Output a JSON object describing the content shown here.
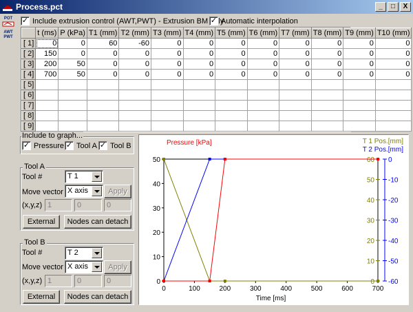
{
  "window": {
    "title": "Process.pct",
    "buttons": {
      "minimize": "_",
      "maximize": "□",
      "close": "X"
    }
  },
  "toolbar_icons": [
    {
      "name": "pot-tool-icon",
      "text": "POT"
    },
    {
      "name": "awt-pwt-tool-icon",
      "text": "AWT PWT"
    }
  ],
  "options": {
    "extrusion_control": {
      "label": "Include extrusion control (AWT,PWT) - Extrusion BM only",
      "checked": true
    },
    "auto_interpolation": {
      "label": "Automatic interpolation",
      "checked": true
    }
  },
  "table": {
    "columns": [
      "t (ms)",
      "P (kPa)",
      "T1 (mm)",
      "T2 (mm)",
      "T3 (mm)",
      "T4 (mm)",
      "T5 (mm)",
      "T6 (mm)",
      "T7 (mm)",
      "T8 (mm)",
      "T9 (mm)",
      "T10 (mm)"
    ],
    "rows": [
      {
        "label": "[ 1]",
        "cells": [
          "0",
          "0",
          "60",
          "-60",
          "0",
          "0",
          "0",
          "0",
          "0",
          "0",
          "0",
          "0"
        ]
      },
      {
        "label": "[ 2]",
        "cells": [
          "150",
          "0",
          "0",
          "0",
          "0",
          "0",
          "0",
          "0",
          "0",
          "0",
          "0",
          "0"
        ]
      },
      {
        "label": "[ 3]",
        "cells": [
          "200",
          "50",
          "0",
          "0",
          "0",
          "0",
          "0",
          "0",
          "0",
          "0",
          "0",
          "0"
        ]
      },
      {
        "label": "[ 4]",
        "cells": [
          "700",
          "50",
          "0",
          "0",
          "0",
          "0",
          "0",
          "0",
          "0",
          "0",
          "0",
          "0"
        ]
      },
      {
        "label": "[ 5]",
        "cells": [
          "",
          "",
          "",
          "",
          "",
          "",
          "",
          "",
          "",
          "",
          "",
          ""
        ]
      },
      {
        "label": "[ 6]",
        "cells": [
          "",
          "",
          "",
          "",
          "",
          "",
          "",
          "",
          "",
          "",
          "",
          ""
        ]
      },
      {
        "label": "[ 7]",
        "cells": [
          "",
          "",
          "",
          "",
          "",
          "",
          "",
          "",
          "",
          "",
          "",
          ""
        ]
      },
      {
        "label": "[ 8]",
        "cells": [
          "",
          "",
          "",
          "",
          "",
          "",
          "",
          "",
          "",
          "",
          "",
          ""
        ]
      },
      {
        "label": "[ 9]",
        "cells": [
          "",
          "",
          "",
          "",
          "",
          "",
          "",
          "",
          "",
          "",
          "",
          ""
        ]
      }
    ]
  },
  "include_graph": {
    "title": "Include to graph...",
    "pressure": {
      "label": "Pressure",
      "checked": true
    },
    "tool_a": {
      "label": "Tool A",
      "checked": true
    },
    "tool_b": {
      "label": "Tool B",
      "checked": true
    }
  },
  "tool_a": {
    "title": "Tool A",
    "tool_label": "Tool #",
    "tool_value": "T 1",
    "move_label": "Move vector",
    "move_value": "X axis",
    "apply": "Apply",
    "xyz_label": "(x,y,z)",
    "x": "1",
    "y": "0",
    "z": "0",
    "external": "External",
    "detach": "Nodes can detach"
  },
  "tool_b": {
    "title": "Tool B",
    "tool_label": "Tool #",
    "tool_value": "T 2",
    "move_label": "Move vector",
    "move_value": "X axis",
    "apply": "Apply",
    "xyz_label": "(x,y,z)",
    "x": "1",
    "y": "0",
    "z": "0",
    "external": "External",
    "detach": "Nodes can detach"
  },
  "colors": {
    "pressure": "#ff0000",
    "t1": "#808000",
    "t2": "#0000ff"
  },
  "chart_data": {
    "type": "line",
    "xlabel": "Time [ms]",
    "xlim": [
      0,
      700
    ],
    "x_ticks": [
      "0",
      "100",
      "200",
      "300",
      "400",
      "500",
      "600",
      "700"
    ],
    "left_axis": {
      "label": "Pressure [kPa]",
      "ylim": [
        0,
        50
      ],
      "ticks": [
        "0",
        "10",
        "20",
        "30",
        "40",
        "50"
      ]
    },
    "right_axis_1": {
      "label": "T 1 Pos.[mm]",
      "ylim": [
        0,
        60
      ],
      "ticks": [
        "0",
        "10",
        "20",
        "30",
        "40",
        "50",
        "60"
      ]
    },
    "right_axis_2": {
      "label": "T 2 Pos.[mm]",
      "ylim": [
        -60,
        0
      ],
      "ticks": [
        "-60",
        "-50",
        "-40",
        "-30",
        "-20",
        "-10",
        "0"
      ]
    },
    "series": [
      {
        "name": "Pressure [kPa]",
        "axis": "left",
        "x": [
          0,
          150,
          200,
          700
        ],
        "y": [
          0,
          0,
          50,
          50
        ]
      },
      {
        "name": "T 1 Pos.[mm]",
        "axis": "right1",
        "x": [
          0,
          150,
          200,
          700
        ],
        "y": [
          60,
          0,
          0,
          0
        ]
      },
      {
        "name": "T 2 Pos.[mm]",
        "axis": "right2",
        "x": [
          0,
          150,
          200,
          700
        ],
        "y": [
          -60,
          0,
          0,
          0
        ]
      }
    ]
  }
}
